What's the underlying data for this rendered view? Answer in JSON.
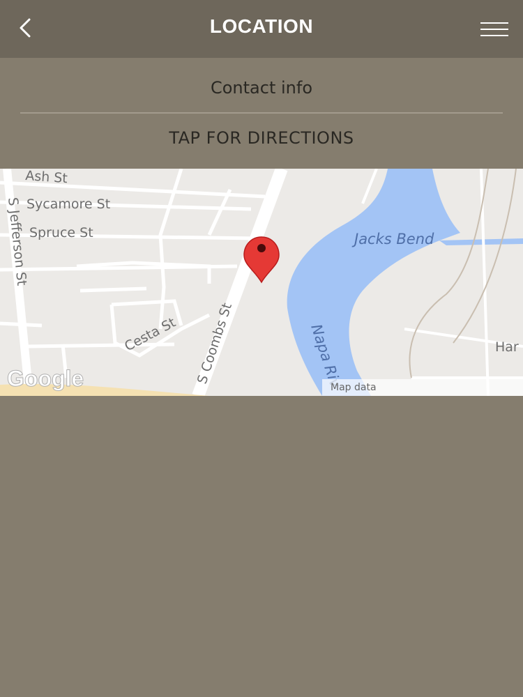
{
  "header": {
    "title": "LOCATION",
    "back_icon": "chevron-left-icon",
    "menu_icon": "hamburger-menu-icon"
  },
  "content": {
    "contact_label": "Contact info",
    "directions_label": "TAP FOR DIRECTIONS"
  },
  "map": {
    "streets": {
      "ash": "Ash St",
      "sycamore": "Sycamore St",
      "spruce": "Spruce St",
      "jefferson": "S Jefferson St",
      "cesta": "Cesta St",
      "coombs": "S Coombs St",
      "partial_right": "Har"
    },
    "water": {
      "jacks_bend": "Jacks Bend",
      "napa_river": "Napa Riv"
    },
    "logo": "Google",
    "attribution": "Map data",
    "marker_icon": "map-pin-icon"
  },
  "colors": {
    "background": "#857d6e",
    "header": "#6e675b",
    "water": "#a3c4f5",
    "marker": "#e53935"
  }
}
